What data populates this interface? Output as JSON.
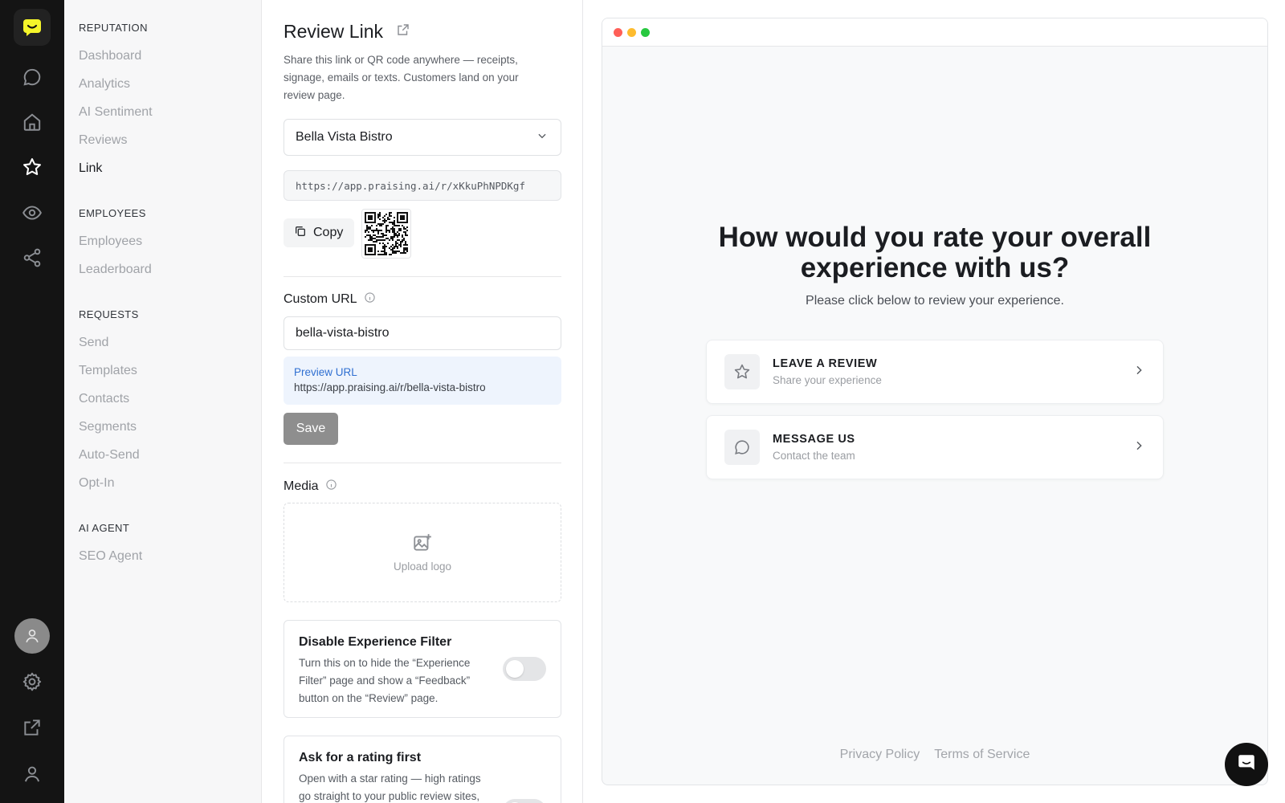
{
  "rail": {
    "icons": [
      "logo-icon",
      "messages-icon",
      "home-icon",
      "star-icon",
      "eye-icon",
      "share-icon",
      "avatar-icon",
      "settings-icon",
      "external-link-icon",
      "profile-icon"
    ]
  },
  "nav": {
    "sections": [
      {
        "title": "REPUTATION",
        "items": [
          "Dashboard",
          "Analytics",
          "AI Sentiment",
          "Reviews",
          "Link"
        ]
      },
      {
        "title": "EMPLOYEES",
        "items": [
          "Employees",
          "Leaderboard"
        ]
      },
      {
        "title": "REQUESTS",
        "items": [
          "Send",
          "Templates",
          "Contacts",
          "Segments",
          "Auto-Send",
          "Opt-In"
        ]
      },
      {
        "title": "AI AGENT",
        "items": [
          "SEO Agent"
        ]
      }
    ],
    "active_item": "Link"
  },
  "settings": {
    "title": "Review Link",
    "description": "Share this link or QR code anywhere — receipts, signage, emails or texts. Customers land on your review page.",
    "location_select": "Bella Vista Bistro",
    "review_url": "https://app.praising.ai/r/xKkuPhNPDKgf",
    "copy_label": "Copy",
    "custom_url_label": "Custom URL",
    "custom_url_value": "bella-vista-bistro",
    "preview_url_label": "Preview URL",
    "preview_url_value": "https://app.praising.ai/r/bella-vista-bistro",
    "save_label": "Save",
    "media_label": "Media",
    "upload_label": "Upload logo",
    "disable_filter": {
      "title": "Disable Experience Filter",
      "description": "Turn this on to hide the “Experience Filter” page and show a “Feedback” button on the “Review” page.",
      "enabled": false
    },
    "rating_first": {
      "title": "Ask for a rating first",
      "description": "Open with a star rating — high ratings go straight to your public review sites,",
      "enabled": false
    }
  },
  "preview": {
    "headline": "How would you rate your overall experience with us?",
    "subline": "Please click below to review your experience.",
    "options": [
      {
        "title": "LEAVE A REVIEW",
        "subtitle": "Share your experience",
        "icon": "star-icon"
      },
      {
        "title": "MESSAGE US",
        "subtitle": "Contact the team",
        "icon": "chat-bubble-icon"
      }
    ],
    "footer": {
      "privacy": "Privacy Policy",
      "terms": "Terms of Service"
    }
  },
  "colors": {
    "brand_yellow": "#f5f52a",
    "rail_bg": "#141414",
    "preview_link": "#2f6fd1",
    "dot_red": "#ff5f57",
    "dot_yellow": "#febc2e",
    "dot_green": "#28c840"
  }
}
